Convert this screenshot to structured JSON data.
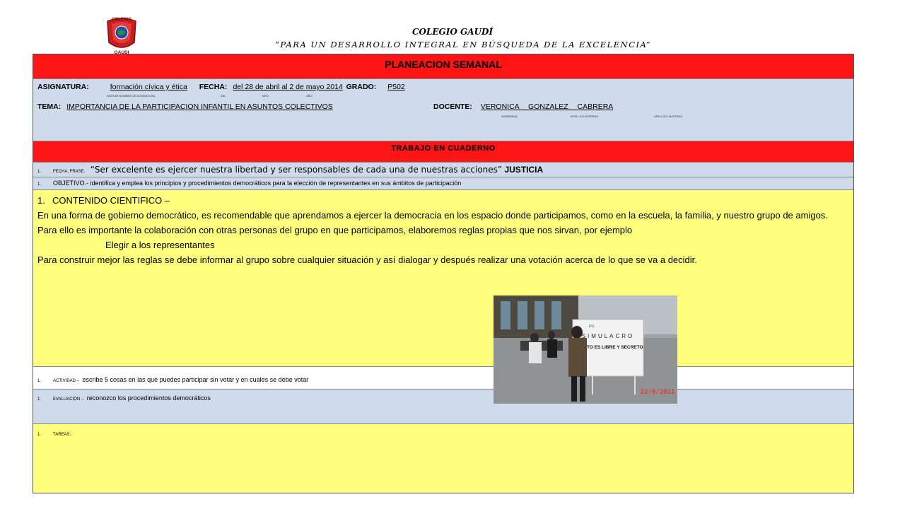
{
  "header": {
    "logo_top_text": "COLEGIO",
    "logo_bottom_text": "GAUDI",
    "school_name": "COLEGIO GAUDÍ",
    "motto": "“PARA UN DESARROLLO INTEGRAL EN BÚSQUEDA DE LA EXCELENCIA”"
  },
  "plan": {
    "title": "PLANEACION SEMANAL",
    "asignatura_label": "ASIGNATURA:",
    "asignatura_value": "formación cívica y ética",
    "fecha_label": "FECHA:",
    "fecha_value": "del 28 de abril al 2 de mayo 2014",
    "grado_label": "GRADO:",
    "grado_value": "P502",
    "sub_asignatura": "ANOTAR NOMBRE DE ASIGNATURA",
    "sub_dia": "DÍA",
    "sub_mes": "MES",
    "sub_anio": "AÑO",
    "tema_label": "TEMA:",
    "tema_value": "IMPORTANCIA DE LA PARTICIPACION INFANTIL EN ASUNTOS COLECTIVOS",
    "docente_label": "DOCENTE:",
    "docente_value": "VERONICA GONZALEZ CABRERA",
    "sub_nombre": "NOMBRE(S)",
    "sub_paterno": "APELLIDO PATERNO",
    "sub_materno": "APELLIDO MATERNO"
  },
  "cuaderno": {
    "title": "TRABAJO EN CUADERNO",
    "item_number": "1.",
    "fecha_frase_label": "FECHA, FRASE.",
    "frase": "“Ser excelente es ejercer nuestra libertad y ser responsables de cada una de nuestras acciones”",
    "valor": "JUSTICIA",
    "objetivo": "OBJETIVO.- identifica y emplea los principios y procedimientos democráticos para la elección de representantes en sus ámbitos de participación",
    "contenido_title": "CONTENIDO CIENTIFICO –",
    "contenido_p1": "En una forma de gobierno democrático, es recomendable que aprendamos a ejercer la democracia en los espacio donde participamos, como en la escuela, la familia, y nuestro grupo de amigos.",
    "contenido_p2": "Para ello es importante la colaboración con otras personas del grupo en que participamos, elaboremos reglas propias que nos sirvan, por ejemplo",
    "contenido_p3": "Elegir a los representantes",
    "contenido_p4": "Para construir mejor las reglas se debe informar al grupo sobre cualquier situación y así dialogar y después realizar una votación acerca de lo que se va a decidir.",
    "actividad_label": "ACTIVIDAD –",
    "actividad_text": "escribe 5 cosas en las que puedes participar sin votar y en cuales se debe votar",
    "evaluacion_label": "EVALUACION –",
    "evaluacion_text": "reconozco los procedimientos democráticos",
    "tareas_label": "TAREAS:."
  },
  "photo": {
    "sign_line1": "SIMULACRO",
    "sign_line2": "EL VOTO ES LIBRE Y SECRETO",
    "ife_label": "IFE",
    "date_stamp": "22/9/2011"
  },
  "colors": {
    "banner_red": "#fd1515",
    "row_blue": "#cfdbeb",
    "row_yellow": "#ffff7e"
  }
}
